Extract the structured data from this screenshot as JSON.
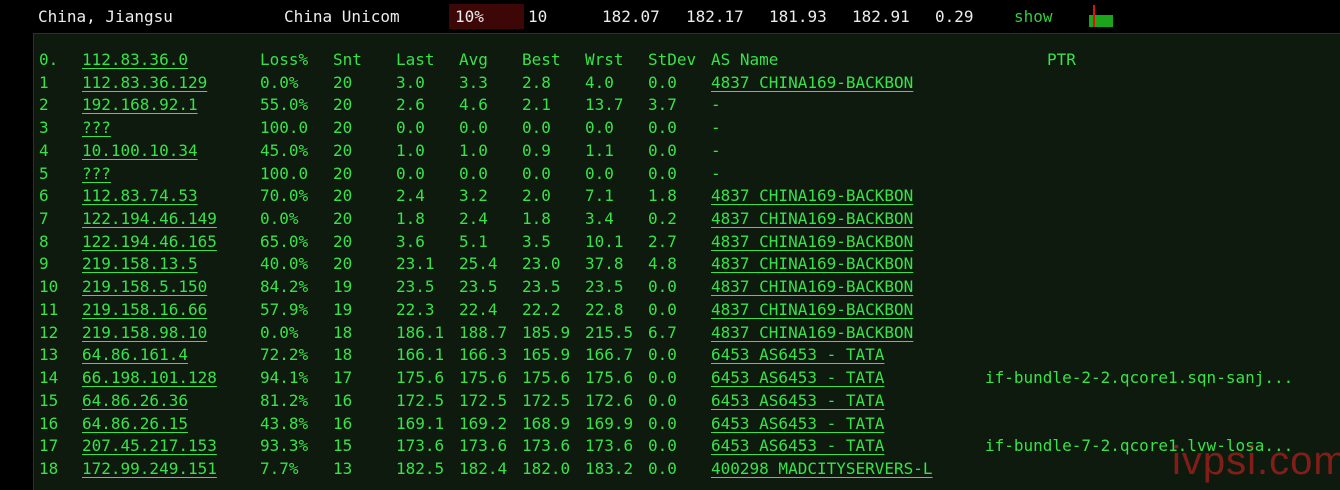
{
  "summary": {
    "location": "China, Jiangsu",
    "isp": "China Unicom",
    "loss": "10%",
    "sent": "10",
    "last": "182.07",
    "avg": "182.17",
    "best": "181.93",
    "worst": "182.91",
    "stdev": "0.29",
    "show_label": "show",
    "colors": {
      "loss_box": "#3d0707",
      "show_link": "#2fcf3a",
      "graph_green": "#1aa51a",
      "graph_red": "#e01010"
    }
  },
  "table": {
    "headers": {
      "hop": "0.",
      "host": "112.83.36.0",
      "loss": "Loss%",
      "snt": "Snt",
      "last": "Last",
      "avg": "Avg",
      "best": "Best",
      "wrst": "Wrst",
      "stdev": "StDev",
      "asname": "AS Name",
      "ptr": "PTR"
    },
    "rows": [
      {
        "hop": "1",
        "host": "112.83.36.129",
        "loss": "0.0%",
        "snt": "20",
        "last": "3.0",
        "avg": "3.3",
        "best": "2.8",
        "wrst": "4.0",
        "stdev": "0.0",
        "asname": "4837  CHINA169-BACKBON",
        "ptr": ""
      },
      {
        "hop": "2",
        "host": "192.168.92.1",
        "loss": "55.0%",
        "snt": "20",
        "last": "2.6",
        "avg": "4.6",
        "best": "2.1",
        "wrst": "13.7",
        "stdev": "3.7",
        "asname": "-",
        "ptr": ""
      },
      {
        "hop": "3",
        "host": "???",
        "loss": "100.0",
        "snt": "20",
        "last": "0.0",
        "avg": "0.0",
        "best": "0.0",
        "wrst": "0.0",
        "stdev": "0.0",
        "asname": "-",
        "ptr": ""
      },
      {
        "hop": "4",
        "host": "10.100.10.34",
        "loss": "45.0%",
        "snt": "20",
        "last": "1.0",
        "avg": "1.0",
        "best": "0.9",
        "wrst": "1.1",
        "stdev": "0.0",
        "asname": "-",
        "ptr": ""
      },
      {
        "hop": "5",
        "host": "???",
        "loss": "100.0",
        "snt": "20",
        "last": "0.0",
        "avg": "0.0",
        "best": "0.0",
        "wrst": "0.0",
        "stdev": "0.0",
        "asname": "-",
        "ptr": ""
      },
      {
        "hop": "6",
        "host": "112.83.74.53",
        "loss": "70.0%",
        "snt": "20",
        "last": "2.4",
        "avg": "3.2",
        "best": "2.0",
        "wrst": "7.1",
        "stdev": "1.8",
        "asname": "4837  CHINA169-BACKBON",
        "ptr": ""
      },
      {
        "hop": "7",
        "host": "122.194.46.149",
        "loss": "0.0%",
        "snt": "20",
        "last": "1.8",
        "avg": "2.4",
        "best": "1.8",
        "wrst": "3.4",
        "stdev": "0.2",
        "asname": "4837  CHINA169-BACKBON",
        "ptr": ""
      },
      {
        "hop": "8",
        "host": "122.194.46.165",
        "loss": "65.0%",
        "snt": "20",
        "last": "3.6",
        "avg": "5.1",
        "best": "3.5",
        "wrst": "10.1",
        "stdev": "2.7",
        "asname": "4837  CHINA169-BACKBON",
        "ptr": ""
      },
      {
        "hop": "9",
        "host": "219.158.13.5",
        "loss": "40.0%",
        "snt": "20",
        "last": "23.1",
        "avg": "25.4",
        "best": "23.0",
        "wrst": "37.8",
        "stdev": "4.8",
        "asname": "4837  CHINA169-BACKBON",
        "ptr": ""
      },
      {
        "hop": "10",
        "host": "219.158.5.150",
        "loss": "84.2%",
        "snt": "19",
        "last": "23.5",
        "avg": "23.5",
        "best": "23.5",
        "wrst": "23.5",
        "stdev": "0.0",
        "asname": "4837  CHINA169-BACKBON",
        "ptr": ""
      },
      {
        "hop": "11",
        "host": "219.158.16.66",
        "loss": "57.9%",
        "snt": "19",
        "last": "22.3",
        "avg": "22.4",
        "best": "22.2",
        "wrst": "22.8",
        "stdev": "0.0",
        "asname": "4837  CHINA169-BACKBON",
        "ptr": ""
      },
      {
        "hop": "12",
        "host": "219.158.98.10",
        "loss": "0.0%",
        "snt": "18",
        "last": "186.1",
        "avg": "188.7",
        "best": "185.9",
        "wrst": "215.5",
        "stdev": "6.7",
        "asname": "4837  CHINA169-BACKBON",
        "ptr": ""
      },
      {
        "hop": "13",
        "host": "64.86.161.4",
        "loss": "72.2%",
        "snt": "18",
        "last": "166.1",
        "avg": "166.3",
        "best": "165.9",
        "wrst": "166.7",
        "stdev": "0.0",
        "asname": "6453  AS6453 - TATA",
        "ptr": ""
      },
      {
        "hop": "14",
        "host": "66.198.101.128",
        "loss": "94.1%",
        "snt": "17",
        "last": "175.6",
        "avg": "175.6",
        "best": "175.6",
        "wrst": "175.6",
        "stdev": "0.0",
        "asname": "6453  AS6453 - TATA",
        "ptr": "if-bundle-2-2.qcore1.sqn-sanj..."
      },
      {
        "hop": "15",
        "host": "64.86.26.36",
        "loss": "81.2%",
        "snt": "16",
        "last": "172.5",
        "avg": "172.5",
        "best": "172.5",
        "wrst": "172.6",
        "stdev": "0.0",
        "asname": "6453  AS6453 - TATA",
        "ptr": ""
      },
      {
        "hop": "16",
        "host": "64.86.26.15",
        "loss": "43.8%",
        "snt": "16",
        "last": "169.1",
        "avg": "169.2",
        "best": "168.9",
        "wrst": "169.9",
        "stdev": "0.0",
        "asname": "6453  AS6453 - TATA",
        "ptr": ""
      },
      {
        "hop": "17",
        "host": "207.45.217.153",
        "loss": "93.3%",
        "snt": "15",
        "last": "173.6",
        "avg": "173.6",
        "best": "173.6",
        "wrst": "173.6",
        "stdev": "0.0",
        "asname": "6453  AS6453 - TATA",
        "ptr": "if-bundle-7-2.qcore1.lvw-losa..."
      },
      {
        "hop": "18",
        "host": "172.99.249.151",
        "loss": "7.7%",
        "snt": "13",
        "last": "182.5",
        "avg": "182.4",
        "best": "182.0",
        "wrst": "183.2",
        "stdev": "0.0",
        "asname": "400298 MADCITYSERVERS-L",
        "ptr": ""
      }
    ]
  },
  "watermark": "ivpsi.com",
  "theme": {
    "text_green": "#38e24a",
    "panel_bg": "#0d1a0d",
    "page_bg": "#000000"
  }
}
